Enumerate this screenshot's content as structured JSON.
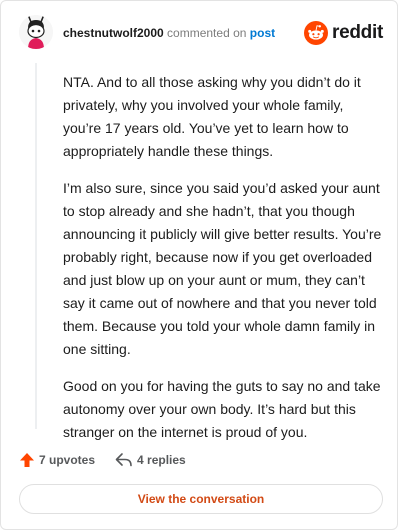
{
  "header": {
    "username": "chestnutwolf2000",
    "action_text": "commented on",
    "link_text": "post",
    "brand_text": "reddit",
    "avatar_icon": "snoo-avatar-icon",
    "brand_icon": "reddit-snoo-icon"
  },
  "comment": {
    "paragraphs": [
      "NTA. And to all those asking why you didn’t do it privately, why you involved your whole family, you’re 17 years old. You’ve yet to learn how to appropriately handle these things.",
      "I’m also sure, since you said you’d asked your aunt to stop already and she hadn’t, that you though announcing it publicly will give better results. You’re probably right, because now if you get overloaded and just blow up on your aunt or mum, they can’t say it came out of nowhere and that you never told them. Because you told your whole damn family in one sitting.",
      "Good on you for having the guts to say no and take autonomy over your own body. It’s hard but this stranger on the internet is proud of you."
    ]
  },
  "footer": {
    "upvotes_label": "7 upvotes",
    "replies_label": "4 replies",
    "upvote_icon": "upvote-arrow-icon",
    "reply_icon": "reply-arrow-icon"
  },
  "cta": {
    "label": "View the conversation"
  },
  "colors": {
    "brand_orange": "#ff4500",
    "link_blue": "#0079d3",
    "cta_text": "#d24a15"
  }
}
